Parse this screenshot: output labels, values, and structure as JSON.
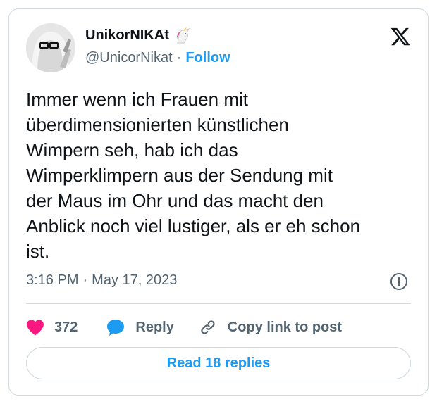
{
  "author": {
    "display_name": "UnikorNIKAt",
    "handle": "@UnicorNikat",
    "separator": "·",
    "follow_label": "Follow",
    "name_emoji": "unicorn-icon"
  },
  "tweet": {
    "lines": [
      "Immer wenn ich Frauen mit",
      "überdimensionierten künstlichen",
      "Wimpern seh, hab ich das",
      "Wimperklimpern aus der Sendung mit",
      "der Maus im Ohr und das macht den",
      "Anblick noch viel lustiger, als er eh schon",
      "ist."
    ],
    "time": "3:16 PM",
    "date": "May 17, 2023",
    "separator": "·"
  },
  "actions": {
    "like_count": "372",
    "reply_label": "Reply",
    "copy_link_label": "Copy link to post"
  },
  "footer": {
    "read_replies_label": "Read 18 replies"
  },
  "colors": {
    "accent": "#1d9bf0",
    "like": "#f91880",
    "border": "#cfd9de",
    "secondary_text": "#536471"
  }
}
